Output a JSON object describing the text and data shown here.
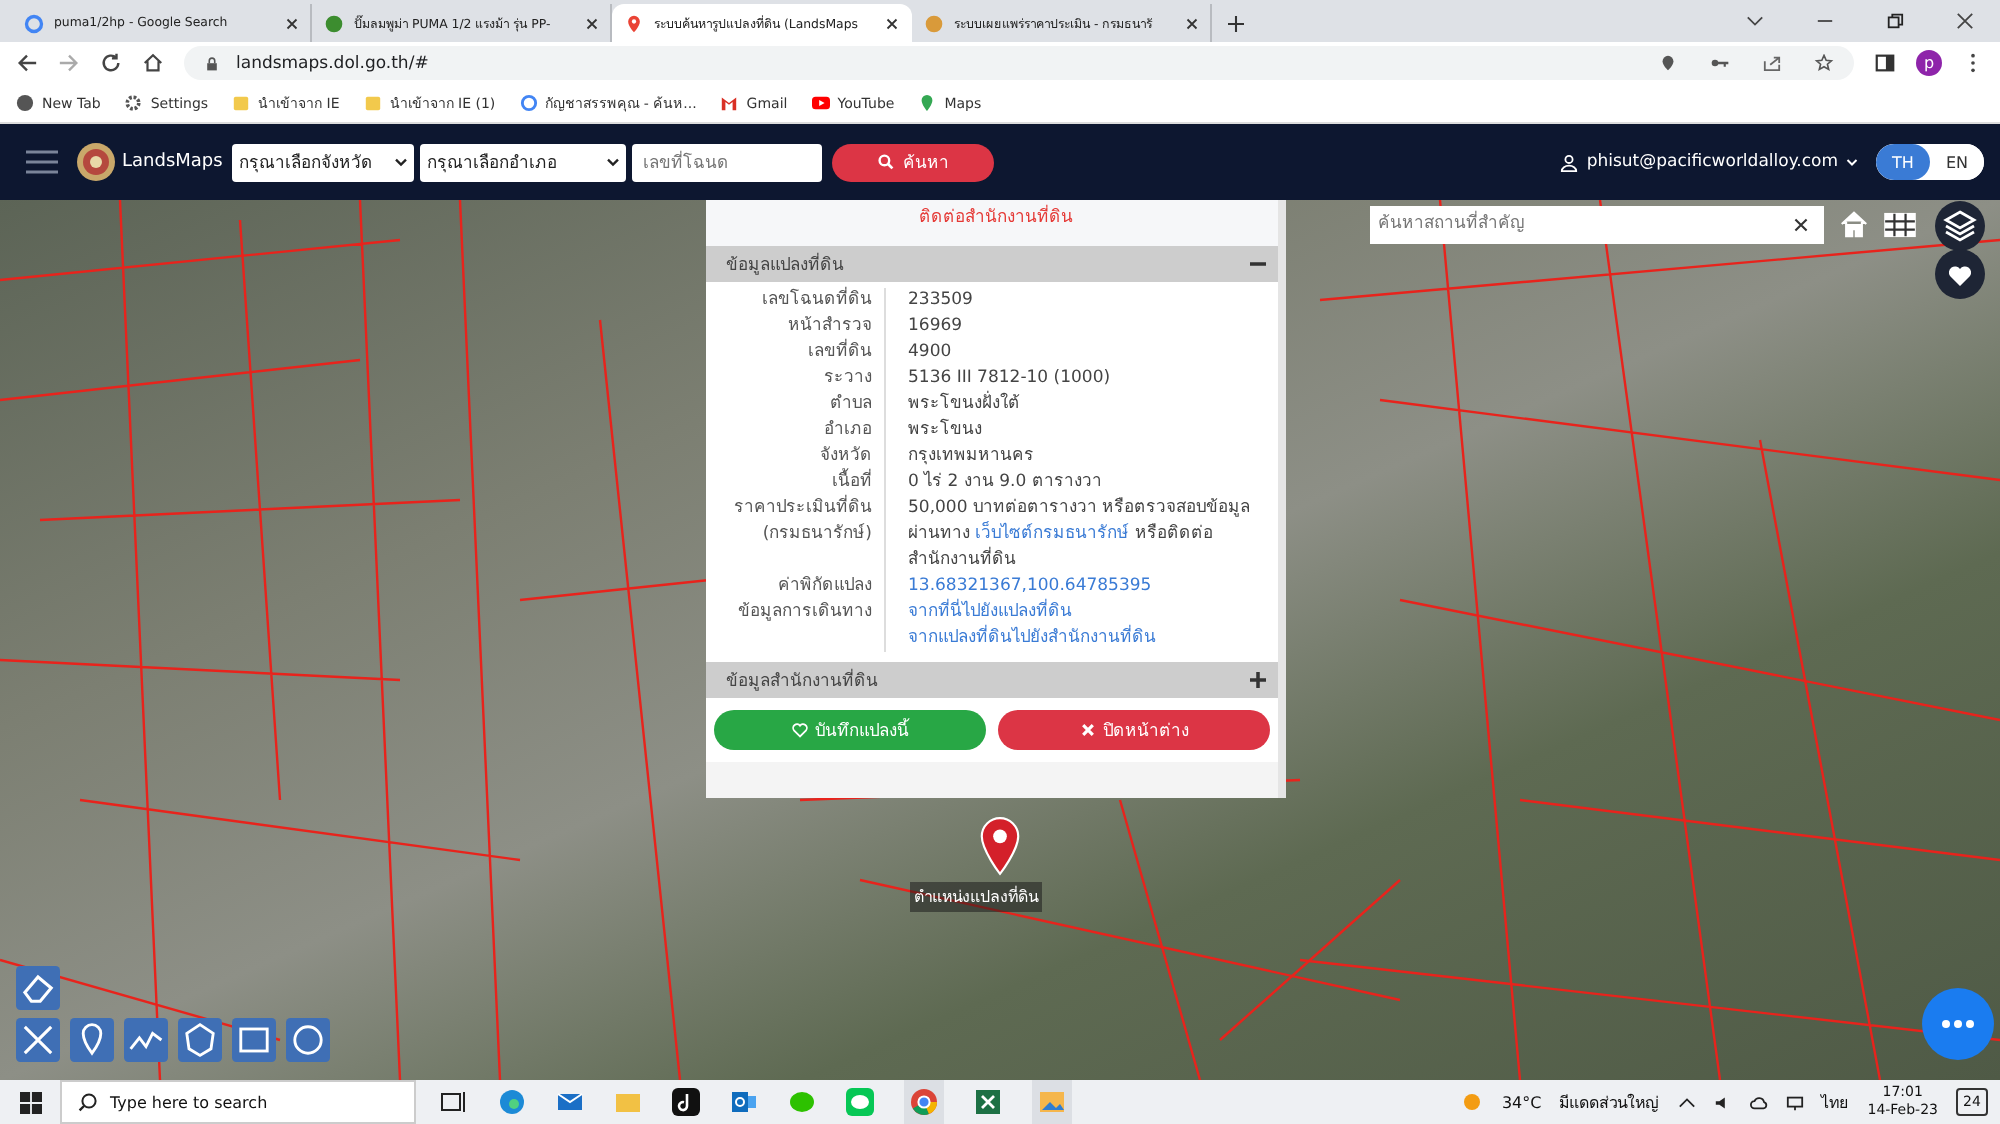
{
  "browser": {
    "tabs": [
      {
        "title": "puma1/2hp - Google Search",
        "kind": "google",
        "selected": false
      },
      {
        "title": "ปั๊มลมพูม่า PUMA 1/2 แรงม้า รุ่น PP-",
        "kind": "frog",
        "selected": false
      },
      {
        "title": "ระบบค้นหารูปแปลงที่ดิน (LandsMaps",
        "kind": "pin",
        "selected": true
      },
      {
        "title": "ระบบเผยแพร่ราคาประเมิน - กรมธนารั",
        "kind": "emblem",
        "selected": false
      }
    ],
    "address": "landsmaps.dol.go.th/#",
    "bookmarks": [
      {
        "label": "New Tab",
        "kind": "globe"
      },
      {
        "label": "Settings",
        "kind": "gear"
      },
      {
        "label": "นำเข้าจาก IE",
        "kind": "folder"
      },
      {
        "label": "นำเข้าจาก IE (1)",
        "kind": "folder"
      },
      {
        "label": "กัญชาสรรพคุณ - ค้นห...",
        "kind": "google"
      },
      {
        "label": "Gmail",
        "kind": "gmail"
      },
      {
        "label": "YouTube",
        "kind": "youtube"
      },
      {
        "label": "Maps",
        "kind": "maps"
      }
    ],
    "profile": "p"
  },
  "header": {
    "logo_text": "LandsMaps",
    "province_placeholder": "กรุณาเลือกจังหวัด",
    "district_placeholder": "กรุณาเลือกอำเภอ",
    "deed_placeholder": "เลขที่โฉนด",
    "search_label": "ค้นหา",
    "user": "phisut@pacificworldalloy.com",
    "languages": [
      {
        "label": "TH",
        "selected": true
      },
      {
        "label": "EN",
        "selected": false
      }
    ]
  },
  "map": {
    "search_placeholder": "ค้นหาสถานที่สำคัญ",
    "marker_label": "ตำแหน่งแปลงที่ดิน"
  },
  "popup": {
    "notice": "ติดต่อสำนักงานที่ดิน",
    "sections": [
      {
        "title": "ข้อมูลแปลงที่ดิน",
        "expanded": true,
        "rows": [
          {
            "label_lines": [
              "เลขโฉนดที่ดิน"
            ],
            "value_lines": [
              [
                {
                  "text": "233509",
                  "kind": "text"
                }
              ]
            ]
          },
          {
            "label_lines": [
              "หน้าสำรวจ"
            ],
            "value_lines": [
              [
                {
                  "text": "16969",
                  "kind": "text"
                }
              ]
            ]
          },
          {
            "label_lines": [
              "เลขที่ดิน"
            ],
            "value_lines": [
              [
                {
                  "text": "4900",
                  "kind": "text"
                }
              ]
            ]
          },
          {
            "label_lines": [
              "ระวาง"
            ],
            "value_lines": [
              [
                {
                  "text": "5136 III 7812-10 (1000)",
                  "kind": "text"
                }
              ]
            ]
          },
          {
            "label_lines": [
              "ตำบล"
            ],
            "value_lines": [
              [
                {
                  "text": "พระโขนงฝั่งใต้",
                  "kind": "text"
                }
              ]
            ]
          },
          {
            "label_lines": [
              "อำเภอ"
            ],
            "value_lines": [
              [
                {
                  "text": "พระโขนง",
                  "kind": "text"
                }
              ]
            ]
          },
          {
            "label_lines": [
              "จังหวัด"
            ],
            "value_lines": [
              [
                {
                  "text": "กรุงเทพมหานคร",
                  "kind": "text"
                }
              ]
            ]
          },
          {
            "label_lines": [
              "เนื้อที่"
            ],
            "value_lines": [
              [
                {
                  "text": "0 ไร่ 2 งาน 9.0 ตารางวา",
                  "kind": "text"
                }
              ]
            ]
          },
          {
            "label_lines": [
              "ราคาประเมินที่ดิน",
              "(กรมธนารักษ์)"
            ],
            "value_lines": [
              [
                {
                  "text": "50,000 บาทต่อตารางวา หรือตรวจสอบข้อมูลผ่านทาง ",
                  "kind": "text"
                },
                {
                  "text": "เว็บไซต์กรมธนารักษ์",
                  "kind": "link"
                },
                {
                  "text": " หรือติดต่อสำนักงานที่ดิน",
                  "kind": "text"
                }
              ]
            ]
          },
          {
            "label_lines": [
              "ค่าพิกัดแปลง"
            ],
            "value_lines": [
              [
                {
                  "text": "13.68321367,100.64785395",
                  "kind": "link"
                }
              ]
            ]
          },
          {
            "label_lines": [
              "ข้อมูลการเดินทาง"
            ],
            "value_lines": [
              [
                {
                  "text": "จากที่นี่ไปยังแปลงที่ดิน",
                  "kind": "link"
                }
              ],
              [
                {
                  "text": "จากแปลงที่ดินไปยังสำนักงานที่ดิน",
                  "kind": "link"
                }
              ]
            ]
          }
        ]
      },
      {
        "title": "ข้อมูลสำนักงานที่ดิน",
        "expanded": false
      }
    ],
    "buttons": [
      {
        "label": "บันทึกแปลงนี้",
        "kind": "save"
      },
      {
        "label": "ปิดหน้าต่าง",
        "kind": "close"
      }
    ]
  },
  "taskbar": {
    "search_placeholder": "Type here to search",
    "temperature": "34°C",
    "weather": "มีแดดส่วนใหญ่",
    "language": "ไทย",
    "time": "17:01",
    "date": "14-Feb-23",
    "notifications": "24"
  }
}
